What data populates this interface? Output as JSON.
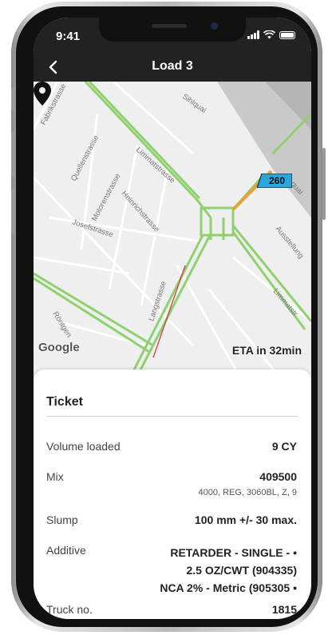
{
  "status_bar": {
    "time": "9:41"
  },
  "nav": {
    "title": "Load 3"
  },
  "map": {
    "streets": [
      "Sihlquai",
      "Fabrikstrasse",
      "Quellenstrasse",
      "Limmatstrasse",
      "Motorenstrasse",
      "Heinrichstrasse",
      "Josefstrasse",
      "Ausstellung",
      "Limmatstr",
      "Röntgen",
      "Langstrasse",
      "quai"
    ],
    "speed_badge": "260",
    "logo": "Google",
    "eta": "ETA in 32min",
    "colors": {
      "road": "#8fd16f",
      "route": "#e9a13b",
      "badge": "#2aa6dc",
      "pin": "#111111"
    }
  },
  "ticket": {
    "title": "Ticket",
    "rows": {
      "volume": {
        "label": "Volume loaded",
        "value": "9 CY"
      },
      "mix": {
        "label": "Mix",
        "value": "409500",
        "detail": "4000, REG, 3060BL, Z, 9"
      },
      "slump": {
        "label": "Slump",
        "value": "100 mm +/- 30 max."
      },
      "additive": {
        "label": "Additive",
        "lines": [
          "RETARDER - SINGLE - •",
          "2.5 OZ/CWT (904335)",
          "NCA 2% - Metric (905305 •"
        ]
      },
      "truck": {
        "label": "Truck no.",
        "value": "1815"
      }
    }
  }
}
